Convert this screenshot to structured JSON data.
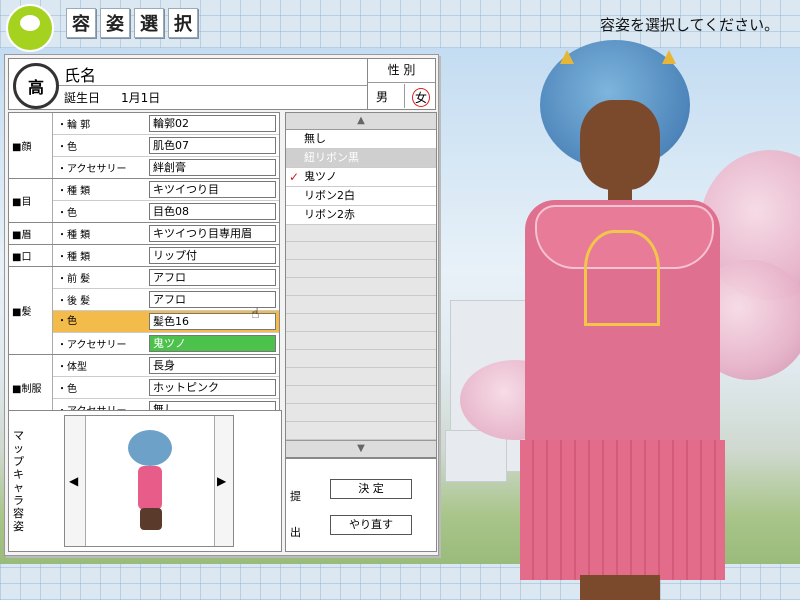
{
  "screen_title": [
    "容",
    "姿",
    "選",
    "択"
  ],
  "instruction": "容姿を選択してください。",
  "profile": {
    "emblem": "高",
    "name_label": "氏名",
    "birthday_label": "誕生日",
    "birthday_value": "1月1日",
    "sex_title": "性 別",
    "sex_male": "男",
    "sex_female": "女",
    "sex_selected": "女"
  },
  "groups": [
    {
      "name": "■顔",
      "rows": [
        {
          "label": "・輪 郭",
          "value": "輪郭02"
        },
        {
          "label": "・色",
          "value": "肌色07"
        },
        {
          "label": "・アクセサリー",
          "value": "絆創膏"
        }
      ]
    },
    {
      "name": "■目",
      "rows": [
        {
          "label": "・種 類",
          "value": "キツイつり目"
        },
        {
          "label": "・色",
          "value": "目色08"
        }
      ]
    },
    {
      "name": "■眉",
      "rows": [
        {
          "label": "・種 類",
          "value": "キツイつり目専用眉"
        }
      ]
    },
    {
      "name": "■口",
      "rows": [
        {
          "label": "・種 類",
          "value": "リップ付"
        }
      ]
    },
    {
      "name": "■髪",
      "rows": [
        {
          "label": "・前 髪",
          "value": "アフロ"
        },
        {
          "label": "・後 髪",
          "value": "アフロ"
        },
        {
          "label": "・色",
          "value": "髪色16"
        },
        {
          "label": "・アクセサリー",
          "value": "鬼ツノ"
        }
      ]
    },
    {
      "name": "■制服",
      "rows": [
        {
          "label": "・体型",
          "value": "長身"
        },
        {
          "label": "・色",
          "value": "ホットピンク"
        },
        {
          "label": "・アクセサリー",
          "value": "無し"
        }
      ]
    }
  ],
  "list": {
    "items": [
      {
        "label": "無し",
        "disabled": false,
        "checked": false
      },
      {
        "label": "紐リボン黒",
        "disabled": true,
        "checked": false
      },
      {
        "label": "鬼ツノ",
        "disabled": false,
        "checked": true
      },
      {
        "label": "リボン2白",
        "disabled": false,
        "checked": false
      },
      {
        "label": "リボン2赤",
        "disabled": false,
        "checked": false
      }
    ]
  },
  "submit": {
    "label": "提出",
    "decide": "決 定",
    "redo": "やり直す"
  },
  "map_char": {
    "label": "マップキャラ容姿"
  },
  "colors": {
    "selected_row": "#f3bb4a",
    "accent_green": "#4cc24c",
    "uniform_pink": "#e0708f",
    "hair_blue": "#5b8fc2"
  }
}
